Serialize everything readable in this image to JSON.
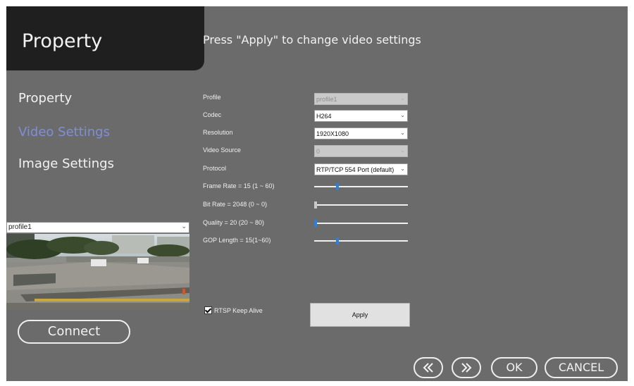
{
  "header": {
    "title": "Property",
    "banner": "Press \"Apply\" to change video settings"
  },
  "sidebar": {
    "items": [
      {
        "label": "Property",
        "active": false
      },
      {
        "label": "Video Settings",
        "active": true
      },
      {
        "label": "Image Settings",
        "active": false
      }
    ],
    "active_color": "#7f8fd6"
  },
  "preview": {
    "selected_profile": "profile1",
    "connect_label": "Connect"
  },
  "settings": {
    "profile": {
      "label": "Profile",
      "value": "profile1",
      "disabled": true
    },
    "codec": {
      "label": "Codec",
      "value": "H264"
    },
    "resolution": {
      "label": "Resolution",
      "value": "1920X1080"
    },
    "video_source": {
      "label": "Video Source",
      "value": "0",
      "disabled": true
    },
    "protocol": {
      "label": "Protocol",
      "value": "RTP/TCP 554 Port (default)"
    },
    "frame_rate": {
      "label": "Frame Rate = 15 (1 ~ 60)",
      "value": 15,
      "min": 1,
      "max": 60
    },
    "bit_rate": {
      "label": "Bit Rate = 2048 (0 ~ 0)",
      "value": 0,
      "min": 0,
      "max": 1
    },
    "quality": {
      "label": "Quality = 20 (20 ~ 80)",
      "value": 20,
      "min": 20,
      "max": 80
    },
    "gop_length": {
      "label": "GOP Length = 15(1~60)",
      "value": 15,
      "min": 1,
      "max": 60
    },
    "rtsp_keep_alive": {
      "label": "RTSP Keep Alive",
      "checked": true
    },
    "apply_label": "Apply"
  },
  "footer": {
    "prev_icon": "double-chevron-left-icon",
    "next_icon": "double-chevron-right-icon",
    "ok_label": "OK",
    "cancel_label": "CANCEL"
  }
}
